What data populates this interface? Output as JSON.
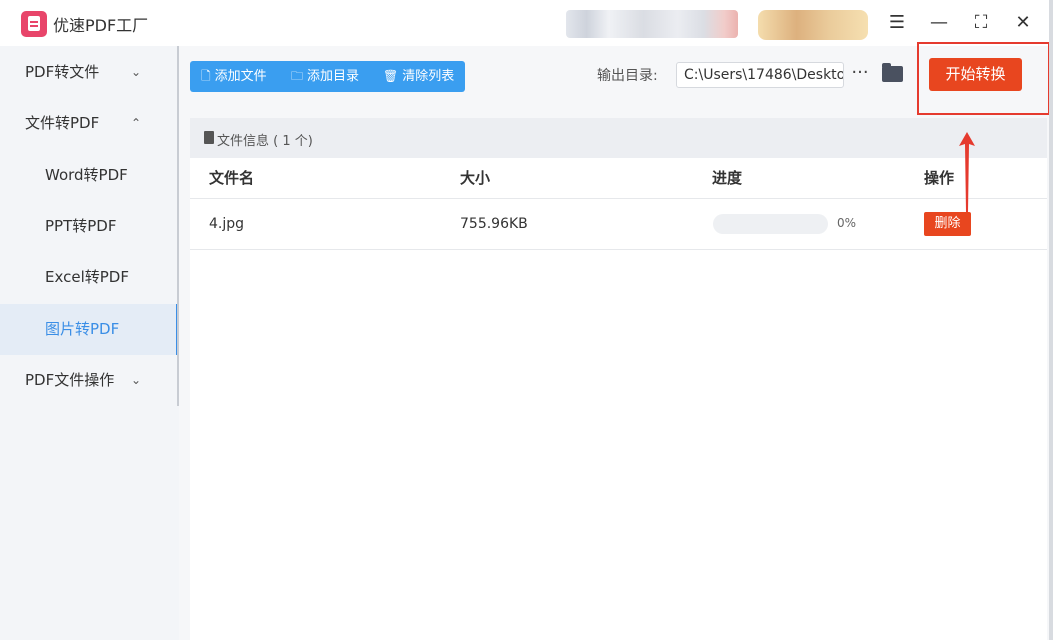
{
  "app": {
    "title": "优速PDF工厂"
  },
  "window": {
    "menu_icon": "☰",
    "min_icon": "—",
    "max_icon": "⛶",
    "close_icon": "✕"
  },
  "sidebar": {
    "items": [
      {
        "label": "PDF转文件",
        "chev": "⌄"
      },
      {
        "label": "文件转PDF",
        "chev": "⌃"
      },
      {
        "label": "Word转PDF"
      },
      {
        "label": "PPT转PDF"
      },
      {
        "label": "Excel转PDF"
      },
      {
        "label": "图片转PDF"
      },
      {
        "label": "PDF文件操作",
        "chev": "⌄"
      }
    ]
  },
  "toolbar": {
    "add_file": "添加文件",
    "add_dir": "添加目录",
    "clear_list": "清除列表",
    "output_label": "输出目录:",
    "output_path": "C:\\Users\\17486\\Deskto",
    "more": "···",
    "start": "开始转换"
  },
  "list": {
    "title": "文件信息 ( 1 个)",
    "columns": [
      "文件名",
      "大小",
      "进度",
      "操作"
    ],
    "rows": [
      {
        "name": "4.jpg",
        "size": "755.96KB",
        "progress": 0,
        "progress_text": "0%",
        "action": "删除"
      }
    ]
  },
  "colors": {
    "accent": "#3a9ef0",
    "danger": "#e8461f",
    "highlight": "#e53a2e"
  }
}
